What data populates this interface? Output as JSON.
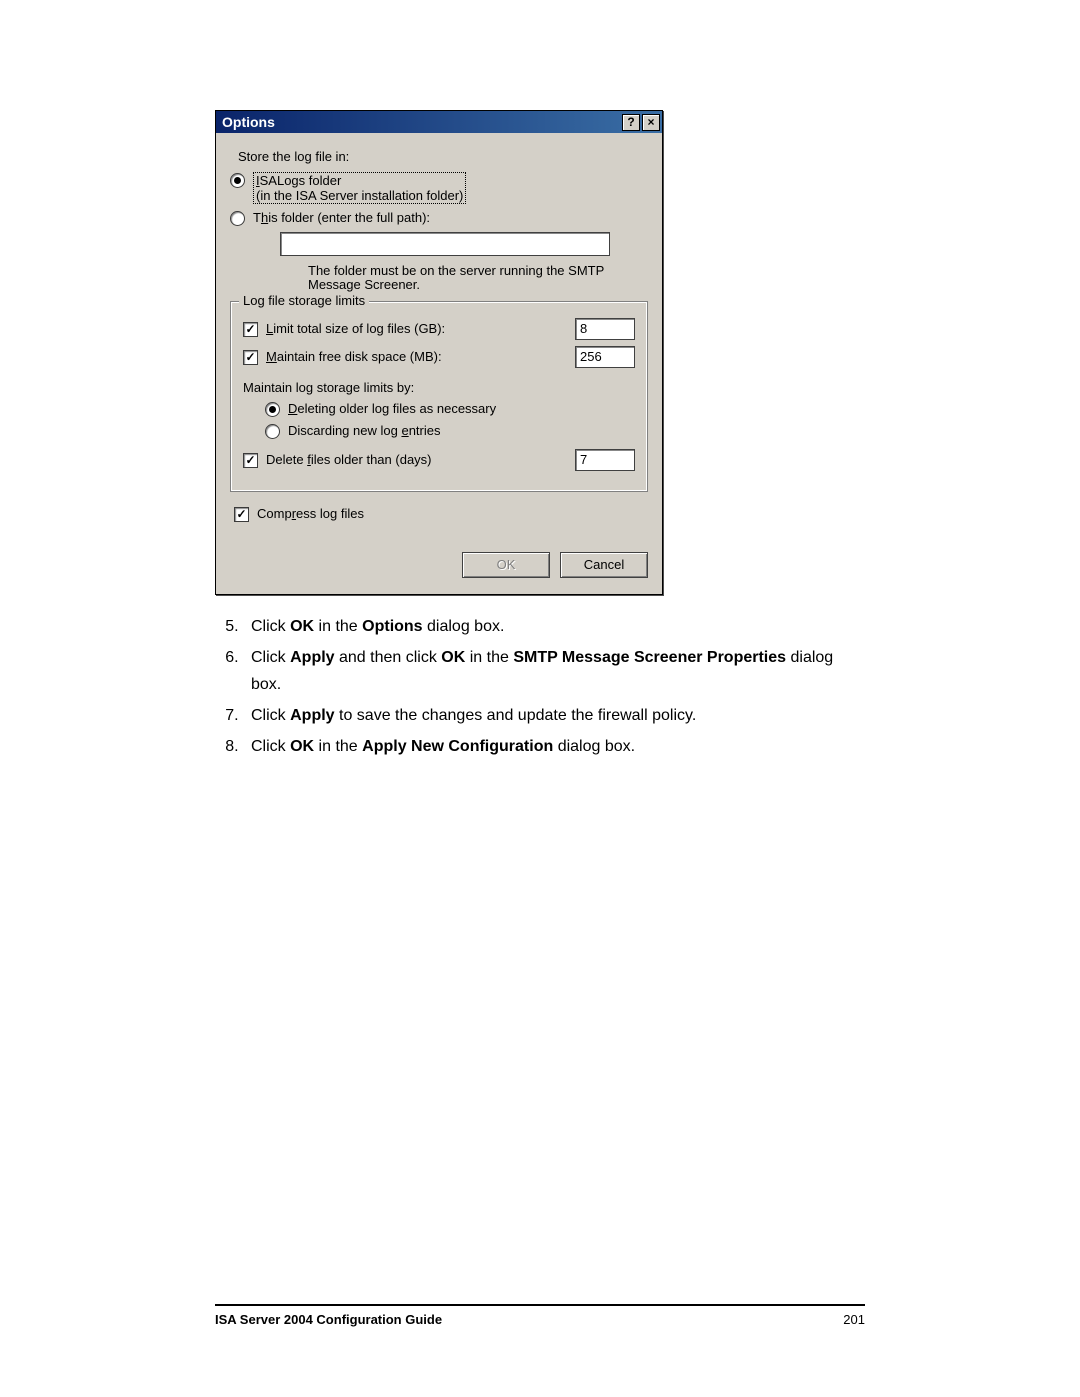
{
  "dialog": {
    "title": "Options",
    "help_glyph": "?",
    "close_glyph": "×",
    "store_label": "Store the log file in:",
    "radio_isalogs_line1": "ISALogs folder",
    "radio_isalogs_line2": "(in the ISA Server installation folder)",
    "radio_thisfolder": "This folder (enter the full path):",
    "path_value": "",
    "hint": "The folder must be on the server running the SMTP Message Screener.",
    "fieldset_legend": "Log file storage limits",
    "chk_limit_total": "Limit total size of log files (GB):",
    "val_limit_total": "8",
    "chk_maintain_free": "Maintain free disk space (MB):",
    "val_maintain_free": "256",
    "maintain_by": "Maintain log storage limits by:",
    "radio_delete_older": "Deleting older log files as necessary",
    "radio_discard_new": "Discarding new log entries",
    "chk_delete_files_older": "Delete files older than (days)",
    "val_delete_files_older": "7",
    "chk_compress": "Compress log files",
    "btn_ok": "OK",
    "btn_cancel": "Cancel"
  },
  "instructions": {
    "start": 5,
    "items": [
      {
        "pre": "Click ",
        "b1": "OK",
        "mid": " in the ",
        "b2": "Options",
        "post": " dialog box."
      },
      {
        "pre": "Click ",
        "b1": "Apply",
        "mid": " and then click ",
        "b2": "OK",
        "mid2": " in the ",
        "b3": "SMTP Message Screener Properties",
        "post": " dialog box."
      },
      {
        "pre": "Click ",
        "b1": "Apply",
        "post": " to save the changes and update the firewall policy."
      },
      {
        "pre": "Click ",
        "b1": "OK",
        "mid": " in the ",
        "b2": "Apply New Configuration",
        "post": " dialog box."
      }
    ]
  },
  "footer": {
    "title": "ISA Server 2004 Configuration Guide",
    "page": "201"
  }
}
